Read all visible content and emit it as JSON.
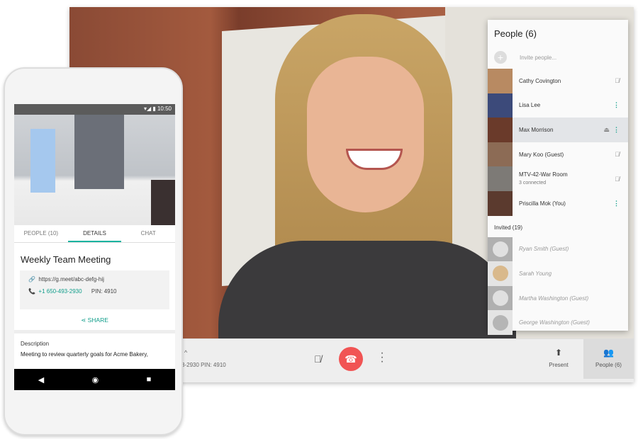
{
  "meeting_bar": {
    "pin_text": "3-2930 PIN: 4910",
    "present_label": "Present",
    "people_label": "People (6)"
  },
  "panel": {
    "title": "People (6)",
    "invite_placeholder": "Invite people...",
    "participants": [
      {
        "name": "Cathy Covington",
        "status": "muted"
      },
      {
        "name": "Lisa Lee",
        "status": "more"
      },
      {
        "name": "Max Morrison",
        "status": "more"
      },
      {
        "name": "Mary Koo (Guest)",
        "status": "muted"
      },
      {
        "name": "MTV-42-War Room",
        "sub": "3 connected",
        "status": "muted"
      },
      {
        "name": "Priscilla Mok (You)",
        "status": "more"
      }
    ],
    "invited_title": "Invited (19)",
    "invited": [
      {
        "name": "Ryan Smith (Guest)"
      },
      {
        "name": "Sarah Young"
      },
      {
        "name": "Martha Washington (Guest)"
      },
      {
        "name": "George Washington (Guest)"
      }
    ]
  },
  "phone": {
    "time": "10:50",
    "tabs": [
      {
        "label": "PEOPLE (10)"
      },
      {
        "label": "DETAILS"
      },
      {
        "label": "CHAT"
      }
    ],
    "meeting_title": "Weekly Team Meeting",
    "link": "https://g.meet/abc-defg-hij",
    "phone_number": "+1 650-493-2930",
    "pin": "PIN: 4910",
    "share_label": "SHARE",
    "description_label": "Description",
    "description": "Meeting to review quarterly goals for Acme Bakery,"
  },
  "colors": {
    "accent": "#0f9d8a",
    "hangup": "#f15454"
  }
}
